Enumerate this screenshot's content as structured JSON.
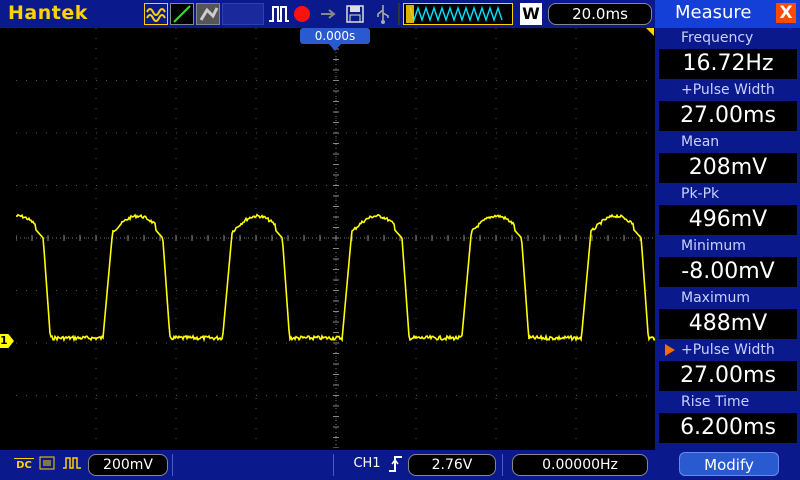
{
  "toolbar": {
    "brand": "Hantek",
    "icons": [
      "wave-style-icon",
      "ramp-wave-icon",
      "persist-icon",
      "pulse-icon",
      "record-icon",
      "arrow-icon",
      "save-icon",
      "usb-icon",
      "memory-wave-icon"
    ],
    "mode_letter": "W",
    "timebase": "20.0ms"
  },
  "display": {
    "trigger_position": "0.000s",
    "channel_marker": "1",
    "trace_color": "#ffff00",
    "grid_color": "#555555"
  },
  "statusbar": {
    "coupling": "DC",
    "channel_volts": "200mV",
    "trigger_source": "CH1",
    "trigger_level": "2.76V",
    "frequency": "0.00000Hz"
  },
  "measure": {
    "title": "Measure",
    "close_label": "X",
    "items": [
      {
        "label": "Frequency",
        "value": "16.72Hz"
      },
      {
        "label": "+Pulse Width",
        "value": "27.00ms"
      },
      {
        "label": "Mean",
        "value": "208mV"
      },
      {
        "label": "Pk-Pk",
        "value": "496mV"
      },
      {
        "label": "Minimum",
        "value": "-8.00mV"
      },
      {
        "label": "Maximum",
        "value": "488mV"
      },
      {
        "label": "+Pulse Width",
        "value": "27.00ms"
      },
      {
        "label": "Rise Time",
        "value": "6.200ms"
      }
    ],
    "selected_index": 6,
    "modify_label": "Modify"
  }
}
